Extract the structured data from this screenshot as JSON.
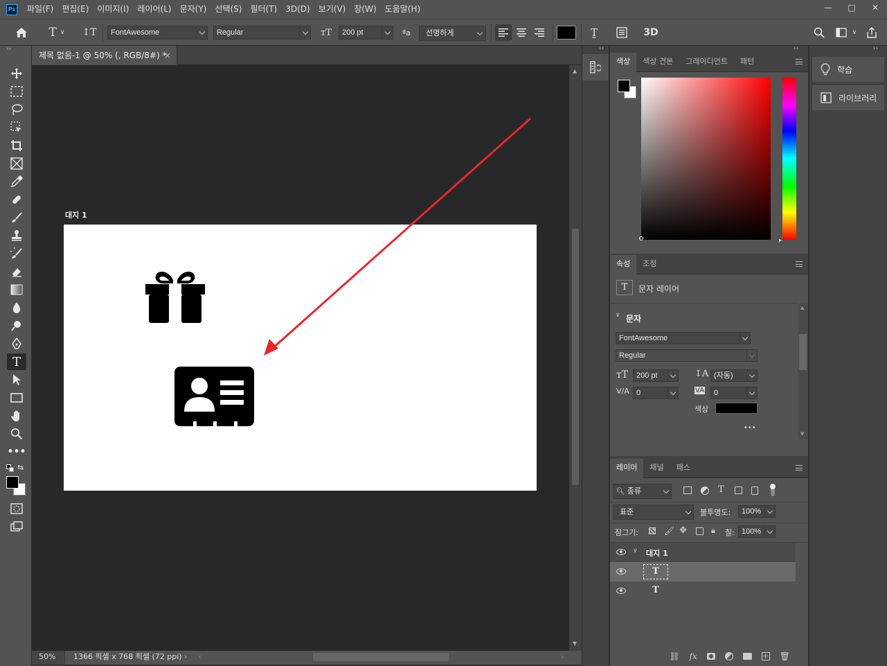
{
  "app": {
    "logo": "Ps"
  },
  "menu": [
    "파일(F)",
    "편집(E)",
    "이미지(I)",
    "레이어(L)",
    "문자(Y)",
    "선택(S)",
    "필터(T)",
    "3D(D)",
    "보기(V)",
    "창(W)",
    "도움말(H)"
  ],
  "window_controls": {
    "minimize": "—",
    "maximize": "□",
    "close": "✕"
  },
  "options": {
    "font_family": "FontAwesome",
    "font_style": "Regular",
    "font_size": "200 pt",
    "aa_label": "ªa",
    "antialias": "선명하게",
    "three_d": "3D",
    "text_color": "#000000"
  },
  "document": {
    "tab_title": "제목 없음-1 @ 50% (, RGB/8#) *",
    "close": "×",
    "artboard_label": "대지 1",
    "zoom": "50%",
    "doc_info": "1366 픽셀 x 768 픽셀 (72 ppi)"
  },
  "color_panel": {
    "tabs": [
      "색상",
      "색상 견본",
      "그레이디언트",
      "패턴"
    ],
    "foreground": "#000000",
    "background": "#ffffff"
  },
  "properties_panel": {
    "tabs": [
      "속성",
      "조정"
    ],
    "layer_type": "문자 레이어",
    "section": "문자",
    "font_family": "FontAwesome",
    "font_style": "Regular",
    "size": "200 pt",
    "leading": "(자동)",
    "kerning": "0",
    "tracking": "0",
    "color_label": "색상",
    "more": "•••"
  },
  "layers_panel": {
    "tabs": [
      "레이어",
      "채널",
      "패스"
    ],
    "filter": "종류",
    "blend_mode": "표준",
    "opacity_label": "불투명도:",
    "opacity": "100%",
    "lock_label": "잠그기:",
    "fill_label": "칠:",
    "fill": "100%",
    "group_name": "대지 1",
    "layers": [
      {
        "name": "",
        "selected": true
      },
      {
        "name": "",
        "selected": false
      }
    ]
  },
  "right_dock": {
    "learn": "학습",
    "libraries": "라이브러리"
  }
}
